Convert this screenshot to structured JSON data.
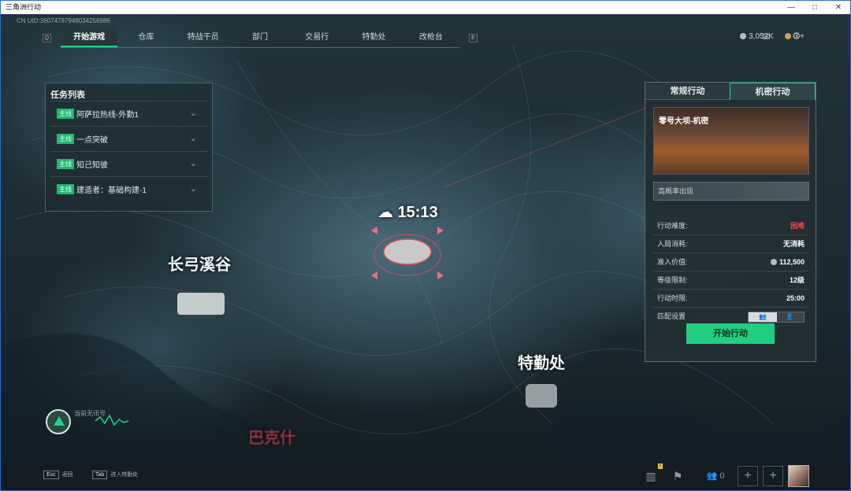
{
  "window": {
    "title": "三角洲行动",
    "controls": [
      "—",
      "□",
      "✕"
    ]
  },
  "top": {
    "uid": "CN UID:36074787948034256986",
    "q_key": "Q",
    "e_key": "E",
    "tabs": [
      "开始游戏",
      "仓库",
      "特战干员",
      "部门",
      "交易行",
      "特勤处",
      "改枪台"
    ],
    "coins": "3,052K",
    "gold": "0",
    "plus": "+"
  },
  "tasks": {
    "title": "任务列表",
    "badge": "主线",
    "items": [
      "阿萨拉热线-外勤1",
      "一点突破",
      "知己知彼",
      "建造者：基础构建-1"
    ]
  },
  "panel": {
    "tab_normal": "常规行动",
    "tab_secret": "机密行动",
    "map_name": "零号大坝-机密",
    "high_prob": "高概率出现",
    "rows": [
      {
        "label": "行动难度:",
        "value": "困难"
      },
      {
        "label": "入局消耗:",
        "value": "无消耗"
      },
      {
        "label": "准入价值:",
        "value": "112,500"
      },
      {
        "label": "等级限制:",
        "value": "12级"
      },
      {
        "label": "行动时限:",
        "value": "25:00"
      },
      {
        "label": "匹配设置",
        "value": ""
      }
    ],
    "start": "开始行动"
  },
  "map": {
    "time": "15:13",
    "places": {
      "changgong": "长弓溪谷",
      "teqin": "特勤处",
      "bakeshi": "巴克什"
    },
    "radio_status": "当前无讯号"
  },
  "bottom": {
    "esc_key": "Esc",
    "esc_label": "返回",
    "tab_key": "Tab",
    "tab_label": "进入特勤处",
    "friends": "0",
    "alert": "!"
  },
  "colors": {
    "accent": "#1ed28a",
    "danger": "#e84a4a"
  },
  "icons": {
    "weather": "cloud-icon",
    "mail": "mail-icon",
    "settings": "gear-icon",
    "stats": "stats-icon",
    "flag": "flag-icon",
    "friends": "friends-icon"
  }
}
